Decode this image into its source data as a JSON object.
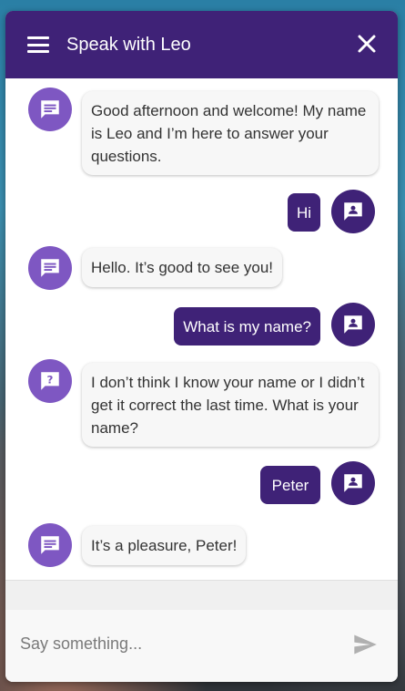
{
  "header": {
    "title": "Speak with Leo"
  },
  "messages": [
    {
      "from": "bot",
      "text": "Good afternoon and welcome! My name is Leo and I’m here to answer your questions."
    },
    {
      "from": "user",
      "text": "Hi"
    },
    {
      "from": "bot",
      "text": "Hello. It’s good to see you!"
    },
    {
      "from": "user",
      "text": "What is my name?"
    },
    {
      "from": "bot",
      "text": "I don’t think I know your name or I didn’t get it correct the last time. What is your name?"
    },
    {
      "from": "user",
      "text": "Peter"
    },
    {
      "from": "bot",
      "text": "It’s a pleasure, Peter!"
    }
  ],
  "input": {
    "placeholder": "Say something..."
  },
  "icons": {
    "menu": "menu-icon",
    "close": "close-icon",
    "bot": "chat-icon",
    "bot_question": "question-chat-icon",
    "user": "person-chat-icon",
    "send": "send-icon"
  },
  "colors": {
    "header": "#3f2277",
    "bot_avatar": "#7e57c2",
    "user_bubble": "#3f2277"
  }
}
